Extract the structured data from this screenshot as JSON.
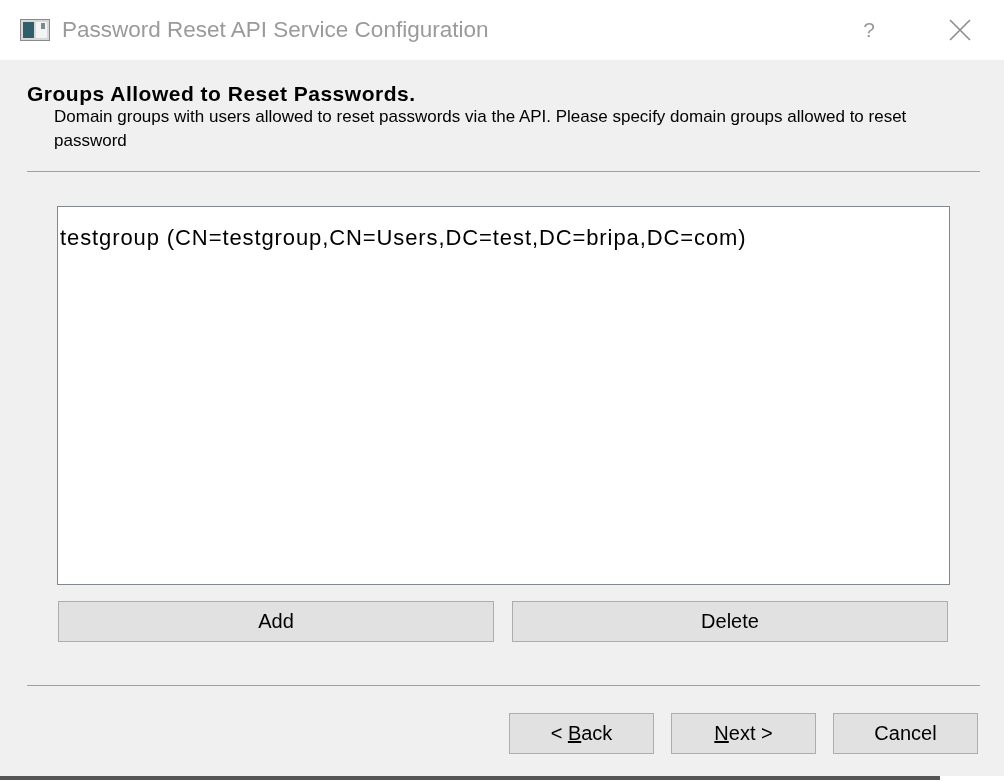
{
  "window": {
    "title": "Password Reset API Service Configuration",
    "help_label": "?"
  },
  "page": {
    "heading": "Groups Allowed to Reset Passwords.",
    "description": "Domain groups with users allowed to reset passwords via the API. Please specify domain groups allowed to reset password"
  },
  "groups_list": {
    "items": [
      {
        "label": "testgroup (CN=testgroup,CN=Users,DC=test,DC=bripa,DC=com)",
        "selected": false
      }
    ]
  },
  "list_buttons": [
    {
      "label": "Add"
    },
    {
      "label": "Delete"
    }
  ],
  "nav_buttons": [
    {
      "text_before_key": "< ",
      "access_key": "B",
      "text_after_key": "ack"
    },
    {
      "access_key": "N",
      "text_after_key": "ext >"
    },
    {
      "label": "Cancel"
    }
  ]
}
